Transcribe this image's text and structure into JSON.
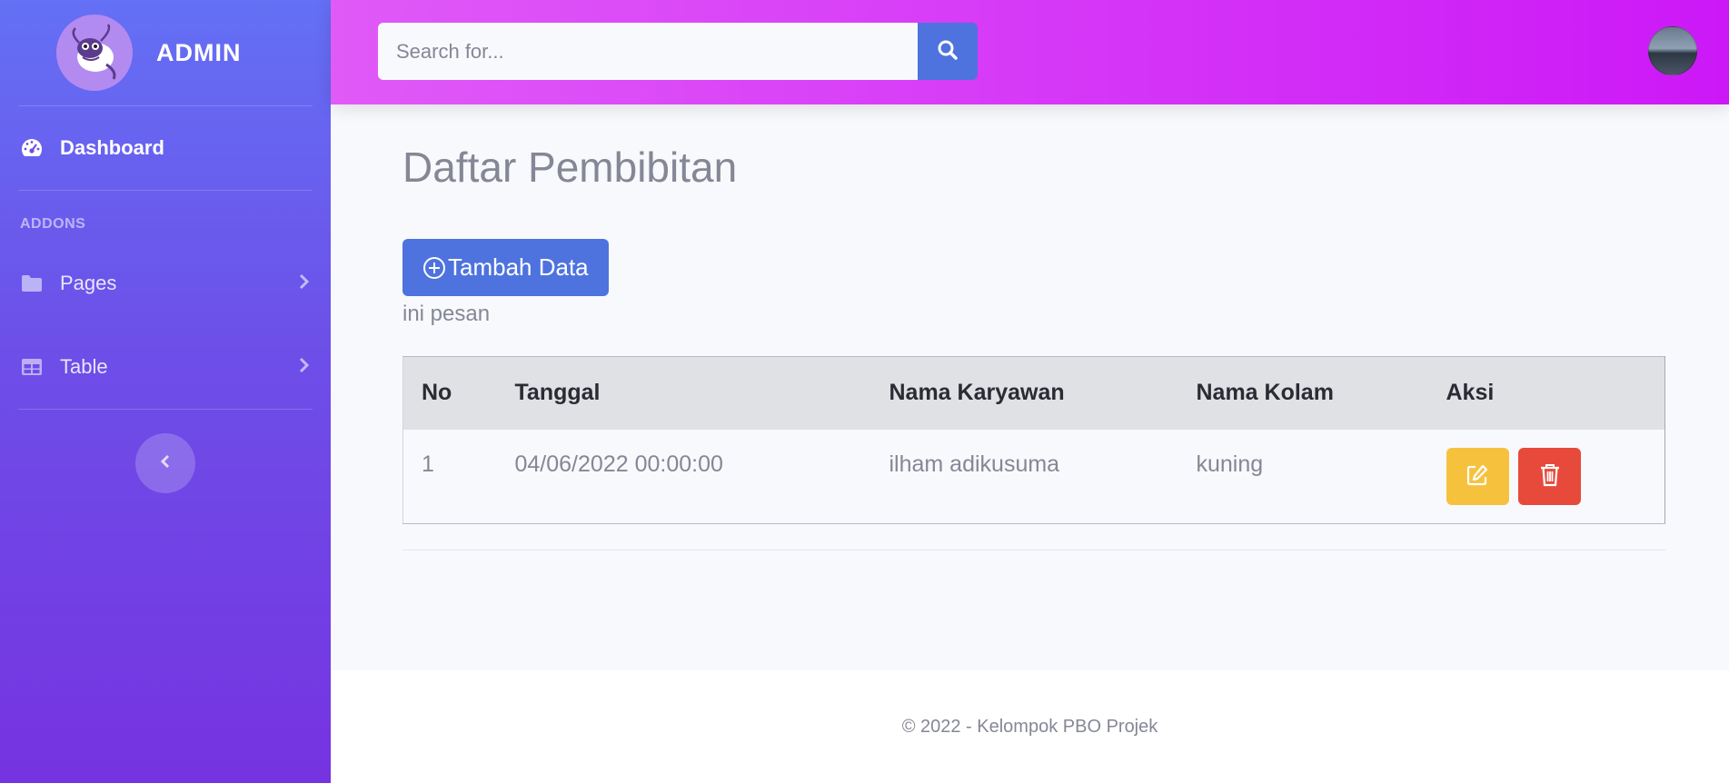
{
  "sidebar": {
    "brand": "ADMIN",
    "dashboard_label": "Dashboard",
    "section_heading": "ADDONS",
    "items": [
      {
        "label": "Pages",
        "icon": "folder-icon"
      },
      {
        "label": "Table",
        "icon": "table-icon"
      }
    ]
  },
  "topbar": {
    "search_placeholder": "Search for..."
  },
  "main": {
    "title": "Daftar Pembibitan",
    "add_button_label": "Tambah Data",
    "message": "ini pesan",
    "table": {
      "headers": [
        "No",
        "Tanggal",
        "Nama Karyawan",
        "Nama Kolam",
        "Aksi"
      ],
      "rows": [
        {
          "no": "1",
          "tanggal": "04/06/2022 00:00:00",
          "nama_karyawan": "ilham adikusuma",
          "nama_kolam": "kuning"
        }
      ]
    }
  },
  "footer": {
    "text": "© 2022 - Kelompok PBO Projek"
  },
  "colors": {
    "primary": "#4e73df",
    "warning": "#f6c23e",
    "danger": "#e74a3b",
    "topbar": "#d93cf7",
    "sidebar": "#6d4fe8"
  }
}
